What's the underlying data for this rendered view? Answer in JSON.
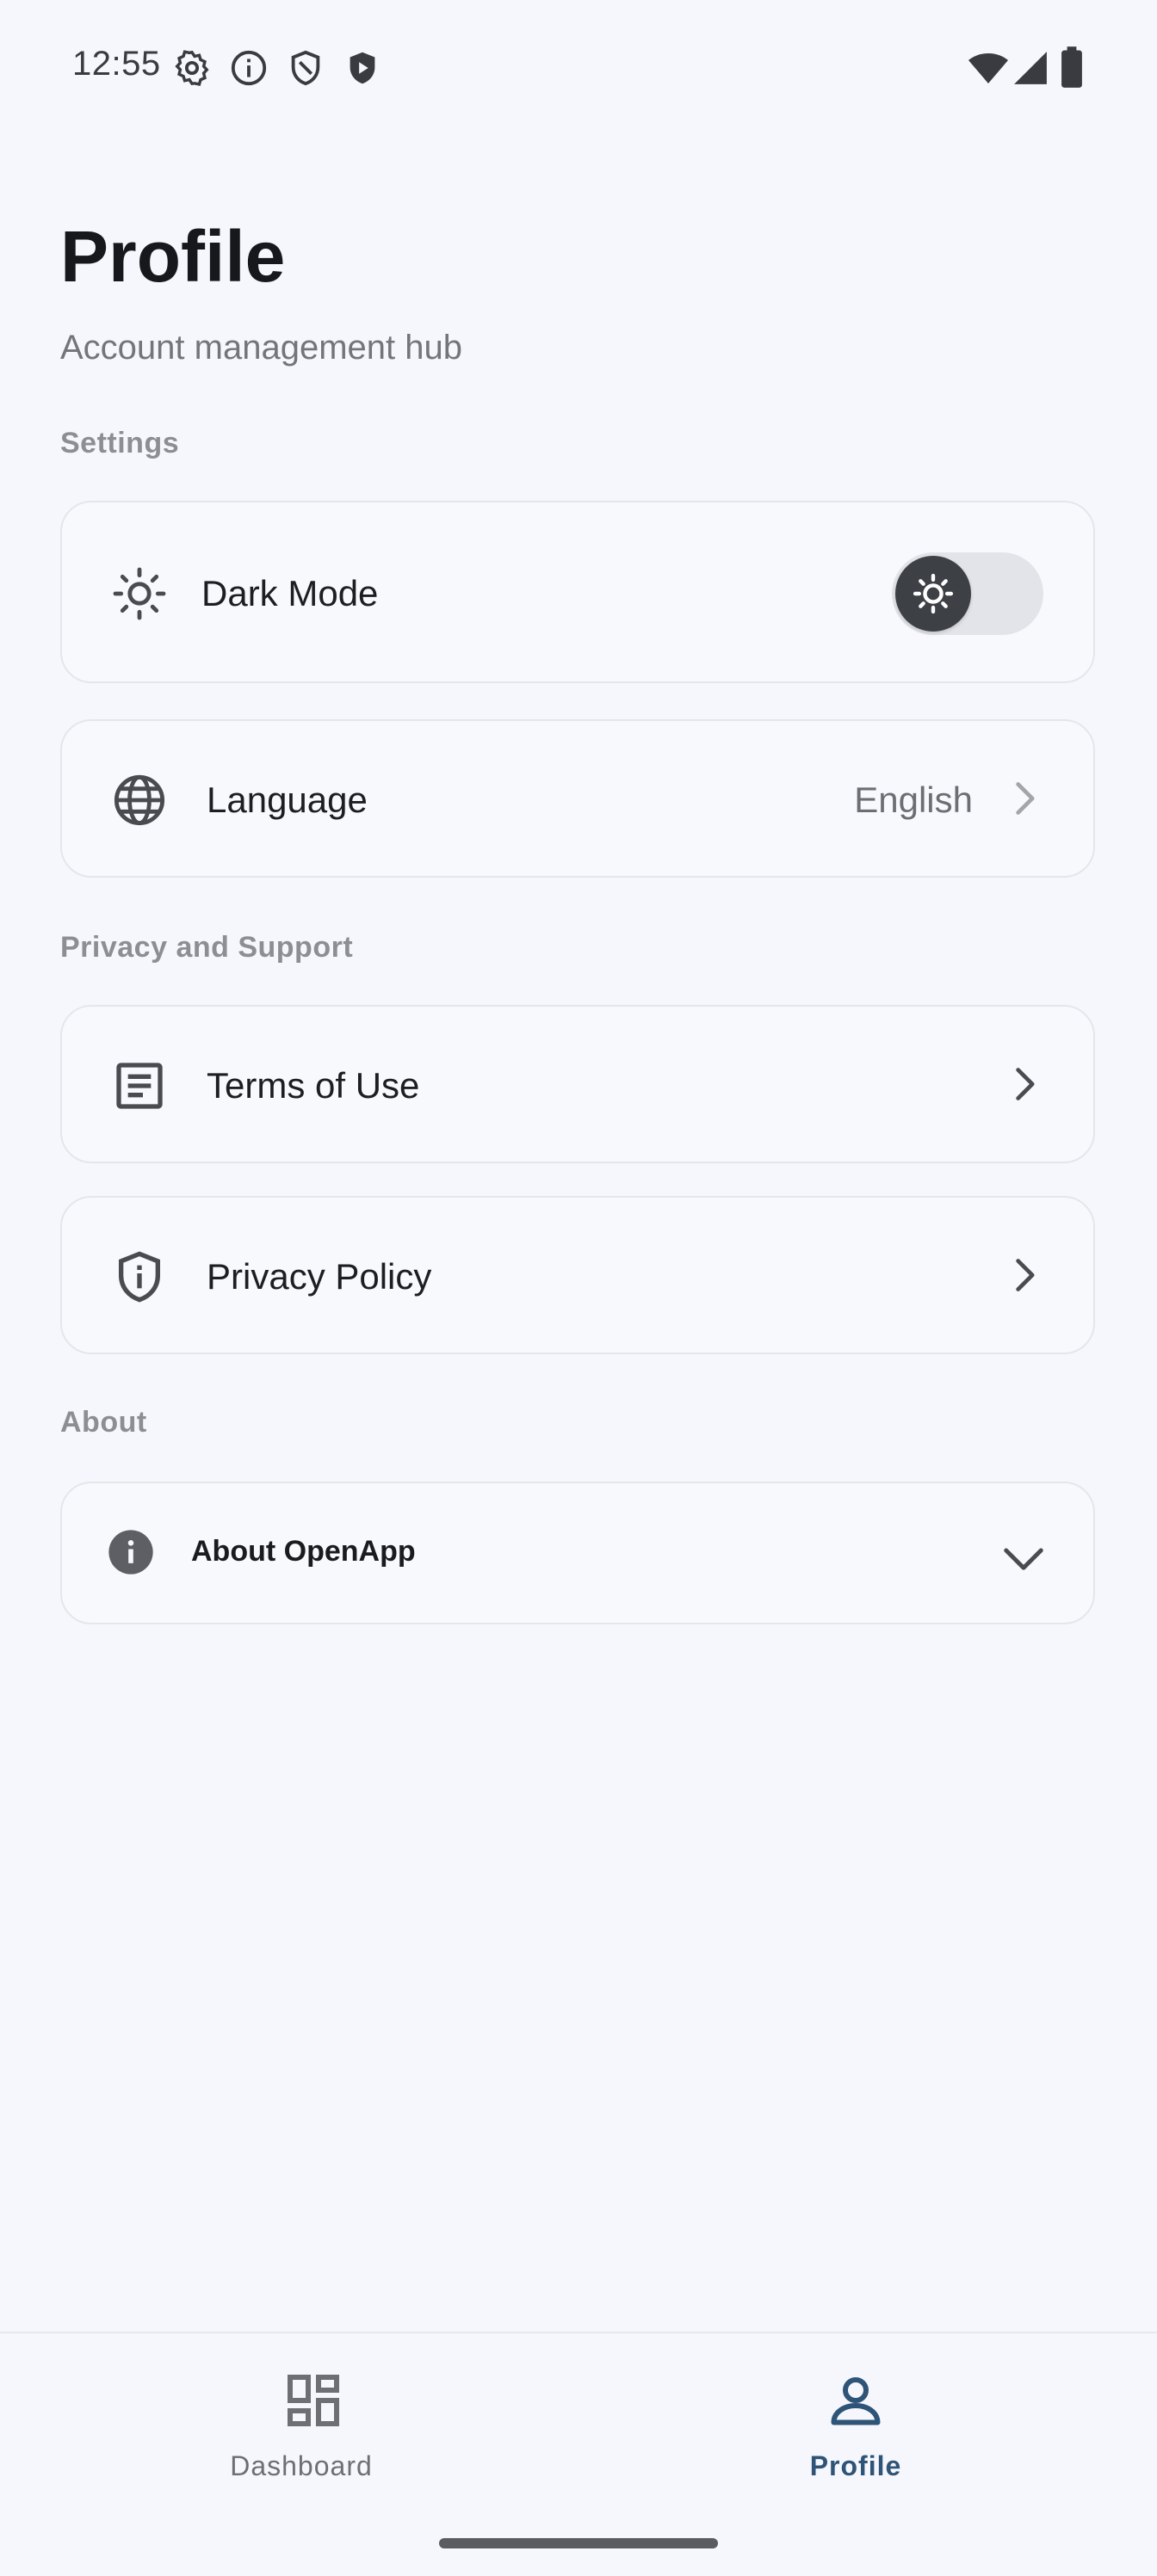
{
  "status_bar": {
    "time": "12:55",
    "icons": [
      "gear-icon",
      "info-icon",
      "shield-icon",
      "shield-play-icon",
      "wifi-icon",
      "signal-icon",
      "battery-icon"
    ]
  },
  "header": {
    "title": "Profile",
    "subtitle": "Account management hub"
  },
  "sections": {
    "settings": {
      "label": "Settings",
      "dark_mode": {
        "label": "Dark Mode",
        "icon": "sun-icon",
        "toggle_on": false
      },
      "language": {
        "label": "Language",
        "value": "English",
        "icon": "globe-icon"
      }
    },
    "privacy": {
      "label": "Privacy and Support",
      "terms": {
        "label": "Terms of Use",
        "icon": "document-icon"
      },
      "policy": {
        "label": "Privacy Policy",
        "icon": "shield-info-icon"
      }
    },
    "about": {
      "label": "About",
      "about_app": {
        "label": "About OpenApp",
        "icon": "info-circle-icon"
      }
    }
  },
  "bottom_nav": {
    "items": [
      {
        "label": "Dashboard",
        "icon": "dashboard-icon",
        "active": false
      },
      {
        "label": "Profile",
        "icon": "person-icon",
        "active": true
      }
    ]
  },
  "colors": {
    "background": "#f6f7fc",
    "accent": "#2e5478",
    "text_primary": "#1b1c20",
    "text_secondary": "#74757b",
    "card_border": "#e5e6ec"
  }
}
